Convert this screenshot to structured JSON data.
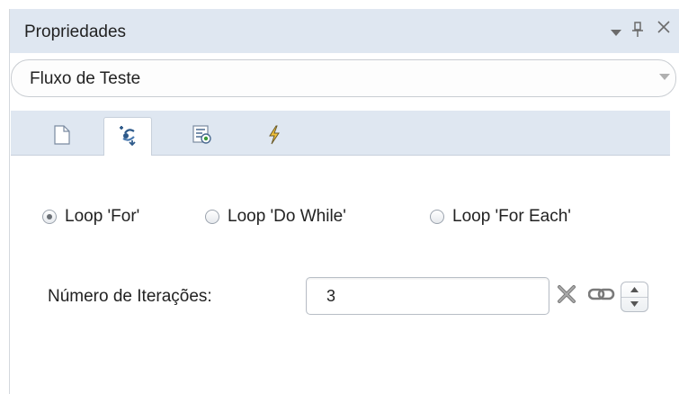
{
  "panel": {
    "title": "Propriedades",
    "title_icons": [
      "dropdown-menu-icon",
      "pin-icon",
      "close-icon"
    ]
  },
  "selector": {
    "value": "Fluxo de Teste"
  },
  "tabs": [
    {
      "name": "document-icon",
      "active": false
    },
    {
      "name": "loop-settings-icon",
      "active": true
    },
    {
      "name": "data-table-icon",
      "active": false
    },
    {
      "name": "event-icon",
      "active": false
    }
  ],
  "loop_options": [
    {
      "label": "Loop 'For'",
      "checked": true
    },
    {
      "label": "Loop 'Do While'",
      "checked": false
    },
    {
      "label": "Loop 'For Each'",
      "checked": false
    }
  ],
  "iterations": {
    "label": "Número de Iterações:",
    "value": "3"
  },
  "colors": {
    "header_bg": "#dfe7f1",
    "border": "#c7d0db",
    "text": "#222222"
  }
}
